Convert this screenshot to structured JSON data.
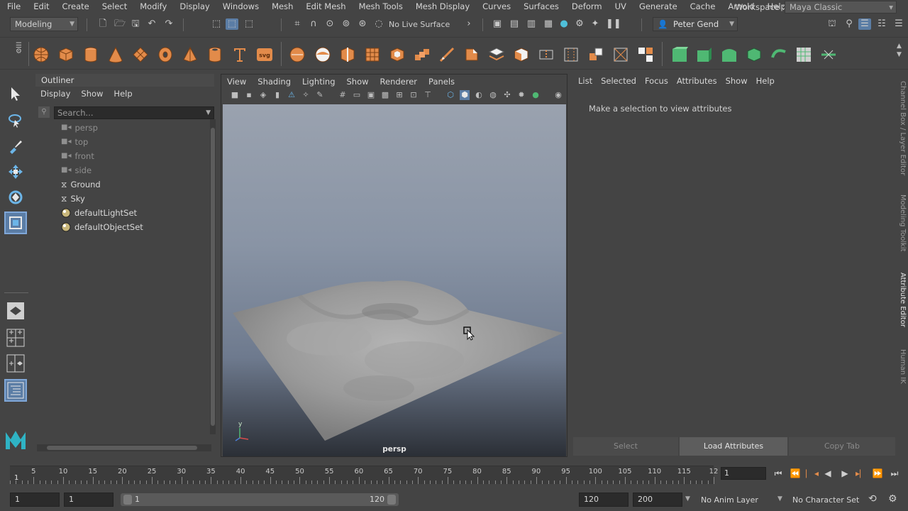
{
  "menubar": {
    "items": [
      "File",
      "Edit",
      "Create",
      "Select",
      "Modify",
      "Display",
      "Windows",
      "Mesh",
      "Edit Mesh",
      "Mesh Tools",
      "Mesh Display",
      "Curves",
      "Surfaces",
      "Deform",
      "UV",
      "Generate",
      "Cache",
      "Arnold",
      "Help"
    ],
    "workspace_label": "Workspace :",
    "workspace_value": "Maya Classic"
  },
  "statusline": {
    "menuset": "Modeling",
    "live_surface": "No Live Surface",
    "user": "Peter Gend"
  },
  "shelf": {
    "colors": {
      "poly": "#e28b4a",
      "green": "#4fb873"
    }
  },
  "outliner": {
    "title": "Outliner",
    "menu": [
      "Display",
      "Show",
      "Help"
    ],
    "search_placeholder": "Search...",
    "items": [
      {
        "label": "persp",
        "icon": "camera-icon",
        "dim": true
      },
      {
        "label": "top",
        "icon": "camera-icon",
        "dim": true
      },
      {
        "label": "front",
        "icon": "camera-icon",
        "dim": true
      },
      {
        "label": "side",
        "icon": "camera-icon",
        "dim": true
      },
      {
        "label": "Ground",
        "icon": "nurbs-surface-icon",
        "dim": false
      },
      {
        "label": "Sky",
        "icon": "nurbs-surface-icon",
        "dim": false
      },
      {
        "label": "defaultLightSet",
        "icon": "set-sphere-icon",
        "dim": false
      },
      {
        "label": "defaultObjectSet",
        "icon": "set-sphere-icon",
        "dim": false
      }
    ]
  },
  "viewport": {
    "menu": [
      "View",
      "Shading",
      "Lighting",
      "Show",
      "Renderer",
      "Panels"
    ],
    "camera_name": "persp",
    "axis": {
      "y": "y"
    }
  },
  "attribute_editor": {
    "menu": [
      "List",
      "Selected",
      "Focus",
      "Attributes",
      "Show",
      "Help"
    ],
    "empty_message": "Make a selection to view attributes",
    "buttons": {
      "select": "Select",
      "load": "Load Attributes",
      "copy": "Copy Tab"
    }
  },
  "side_tabs": [
    "Channel Box / Layer Editor",
    "Modeling Toolkit",
    "Attribute Editor",
    "Human IK"
  ],
  "timeslider": {
    "ticks": [
      "5",
      "10",
      "15",
      "20",
      "25",
      "30",
      "35",
      "40",
      "45",
      "50",
      "55",
      "60",
      "65",
      "70",
      "75",
      "80",
      "85",
      "90",
      "95",
      "100",
      "105",
      "110",
      "115",
      "12"
    ],
    "start_label": "1",
    "current_frame": "1"
  },
  "rangeslider": {
    "start_field": "1",
    "playback_start": "1",
    "range_start": "1",
    "range_end": "120",
    "playback_end": "120",
    "anim_end": "200",
    "anim_layer": "No Anim Layer",
    "character_set": "No Character Set"
  }
}
